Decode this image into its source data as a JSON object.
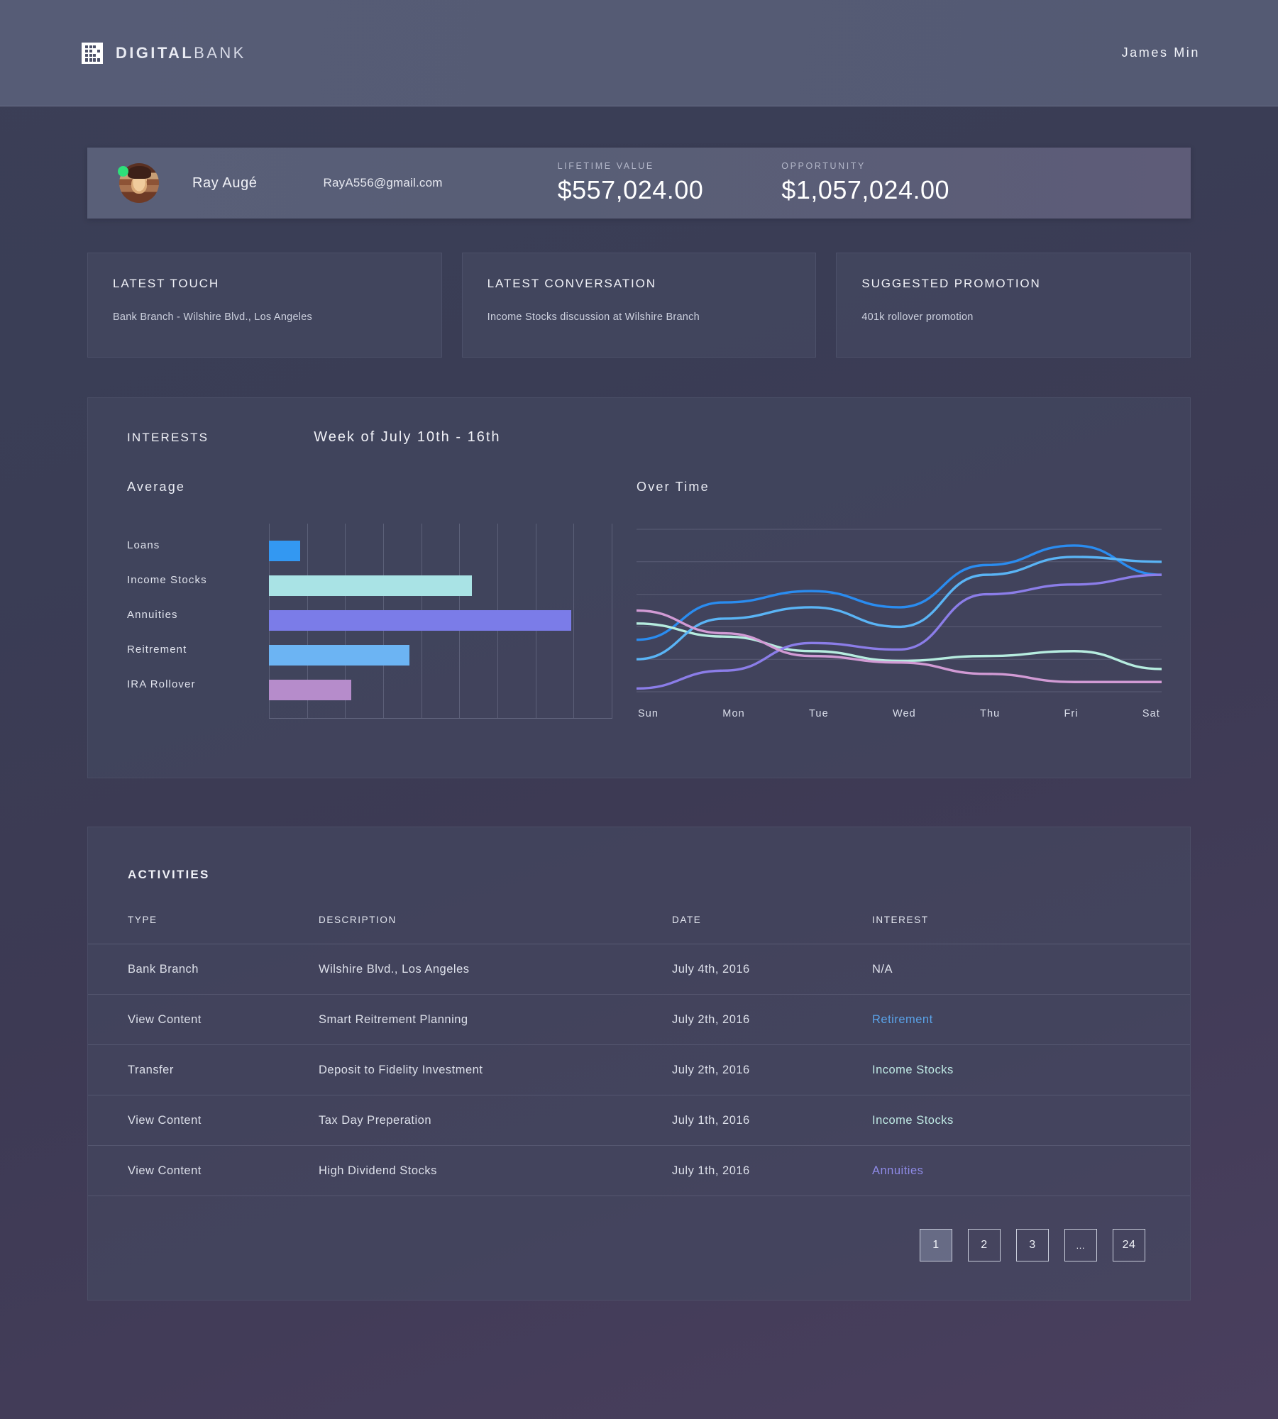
{
  "header": {
    "brand_bold": "DIGITAL",
    "brand_light": "BANK",
    "logo_icon": "building-grid-icon",
    "user_name": "James Min"
  },
  "profile": {
    "name": "Ray Augé",
    "email": "RayA556@gmail.com",
    "status": "online",
    "lifetime_label": "LIFETIME VALUE",
    "lifetime_value": "$557,024.00",
    "opportunity_label": "OPPORTUNITY",
    "opportunity_value": "$1,057,024.00"
  },
  "info_cards": [
    {
      "title": "LATEST TOUCH",
      "text": "Bank Branch  -  Wilshire Blvd., Los Angeles"
    },
    {
      "title": "LATEST CONVERSATION",
      "text": "Income Stocks discussion at Wilshire Branch"
    },
    {
      "title": "SUGGESTED PROMOTION",
      "text": "401k rollover promotion"
    }
  ],
  "interests": {
    "title": "INTERESTS",
    "week": "Week of July 10th - 16th",
    "average_title": "Average",
    "overtime_title": "Over Time"
  },
  "chart_data": [
    {
      "type": "bar",
      "title": "Average",
      "orientation": "horizontal",
      "categories": [
        "Loans",
        "Income Stocks",
        "Annuities",
        "Reitrement",
        "IRA Rollover"
      ],
      "values": [
        9,
        59,
        88,
        41,
        24
      ],
      "colors": [
        "#3398f2",
        "#a9e3e5",
        "#7b7ce8",
        "#6cb4f3",
        "#b68ccb"
      ],
      "xlim": [
        0,
        100
      ],
      "grid": true,
      "xlabel": "",
      "ylabel": ""
    },
    {
      "type": "line",
      "title": "Over Time",
      "x": [
        "Sun",
        "Mon",
        "Tue",
        "Wed",
        "Thu",
        "Fri",
        "Sat"
      ],
      "ylim": [
        0,
        100
      ],
      "grid": true,
      "legend": "none",
      "series": [
        {
          "name": "Loans",
          "color": "#2a8cf0",
          "values": [
            32,
            55,
            62,
            52,
            78,
            90,
            72
          ]
        },
        {
          "name": "Income Stocks",
          "color": "#b6ecdf",
          "values": [
            42,
            34,
            25,
            19,
            22,
            25,
            14
          ]
        },
        {
          "name": "Annuities",
          "color": "#8b7de8",
          "values": [
            2,
            13,
            30,
            26,
            60,
            66,
            72
          ]
        },
        {
          "name": "Reitrement",
          "color": "#5ab4f5",
          "values": [
            20,
            45,
            52,
            40,
            72,
            83,
            80
          ]
        },
        {
          "name": "IRA Rollover",
          "color": "#d19ad4",
          "values": [
            50,
            36,
            22,
            18,
            11,
            6,
            6
          ]
        }
      ]
    }
  ],
  "activities": {
    "title": "ACTIVITIES",
    "columns": [
      "TYPE",
      "DESCRIPTION",
      "DATE",
      "INTEREST"
    ],
    "rows": [
      {
        "type": "Bank Branch",
        "description": "Wilshire Blvd., Los Angeles",
        "date": "July 4th, 2016",
        "interest": "N/A",
        "interest_color": "#dde0ea"
      },
      {
        "type": "View Content",
        "description": "Smart Reitrement Planning",
        "date": "July 2th, 2016",
        "interest": "Retirement",
        "interest_color": "#5aa3e8"
      },
      {
        "type": "Transfer",
        "description": "Deposit to Fidelity Investment",
        "date": "July 2th, 2016",
        "interest": "Income Stocks",
        "interest_color": "#bfe9e4"
      },
      {
        "type": "View Content",
        "description": "Tax Day Preperation",
        "date": "July 1th, 2016",
        "interest": "Income Stocks",
        "interest_color": "#bfe9e4"
      },
      {
        "type": "View Content",
        "description": "High Dividend Stocks",
        "date": "July 1th, 2016",
        "interest": "Annuities",
        "interest_color": "#8e8ae6"
      }
    ],
    "pagination": {
      "pages": [
        "1",
        "2",
        "3",
        "…",
        "24"
      ],
      "active": "1"
    }
  }
}
